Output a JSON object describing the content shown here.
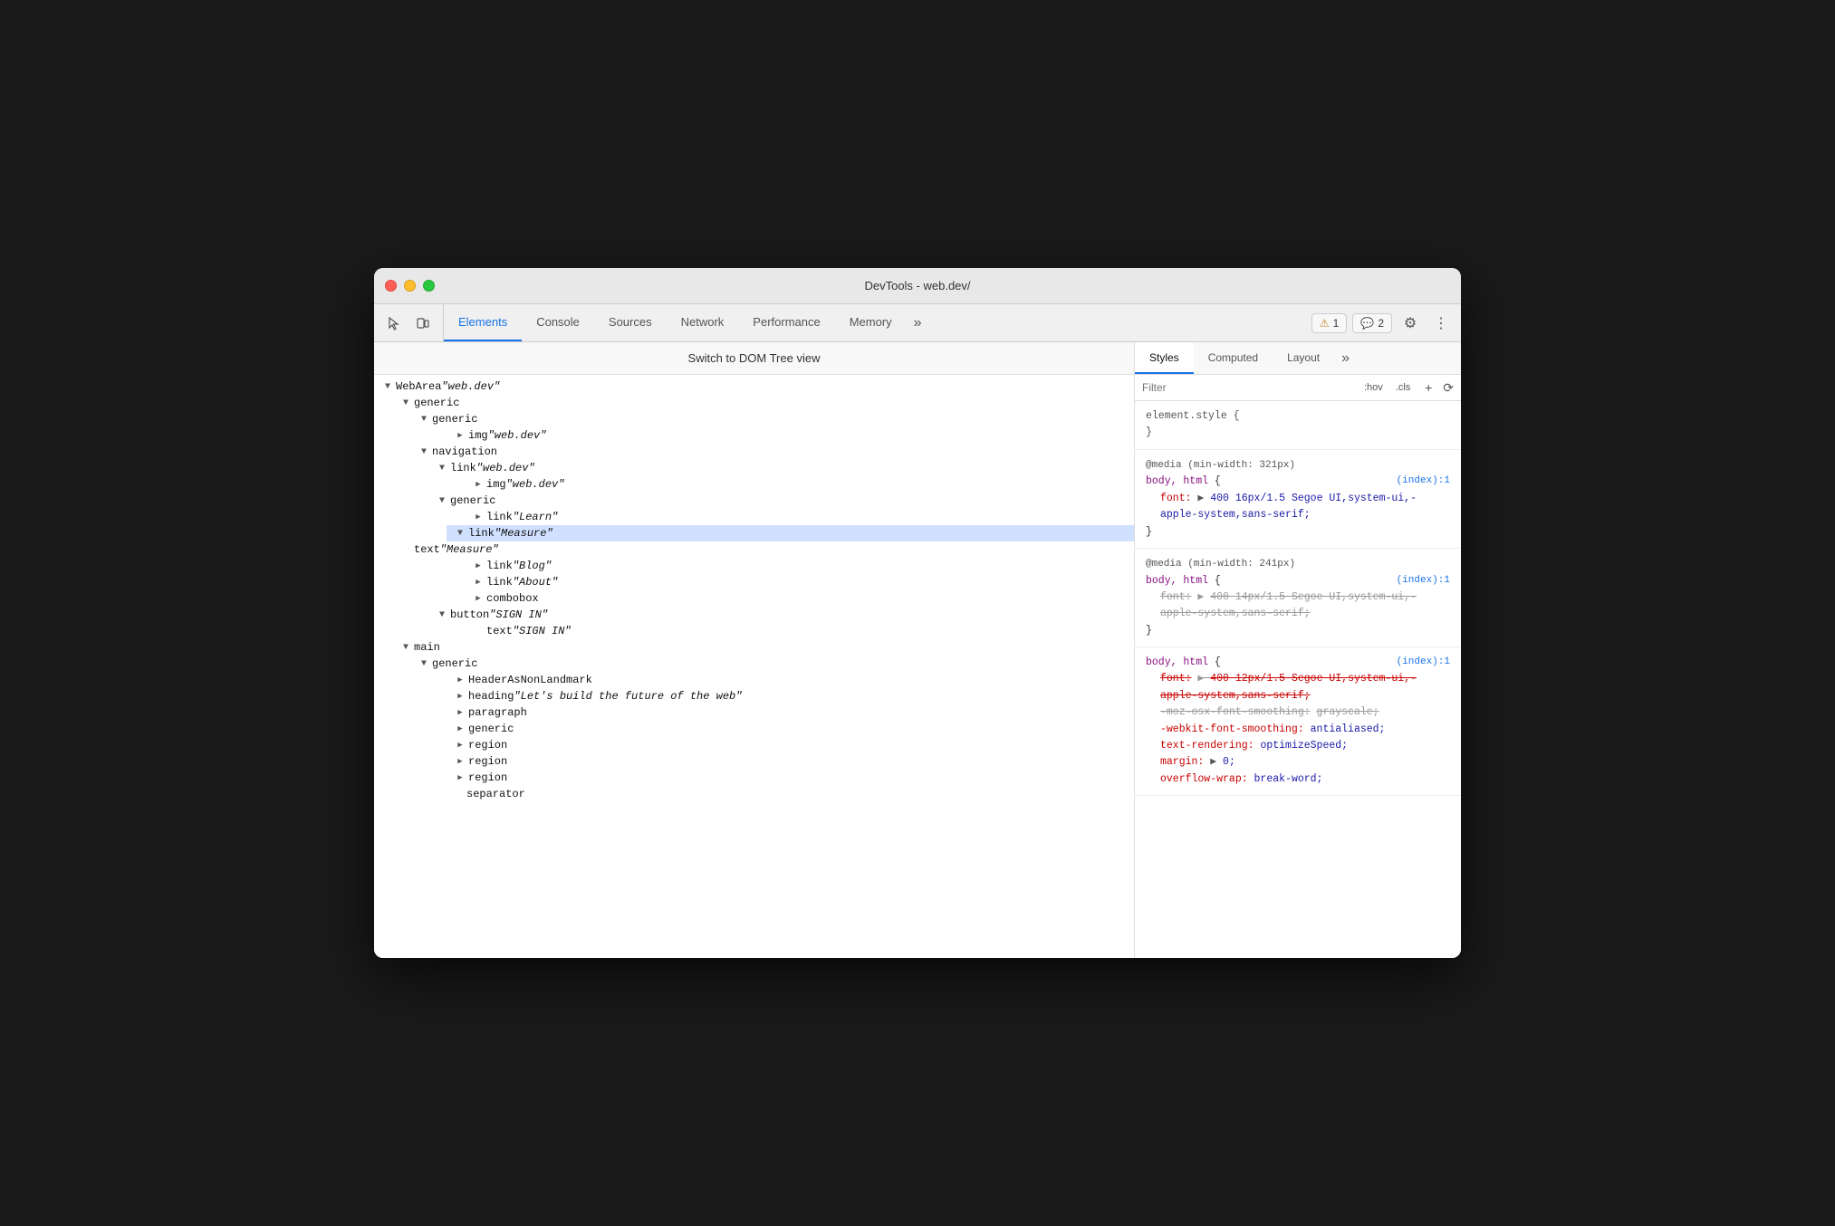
{
  "window": {
    "title": "DevTools - web.dev/"
  },
  "toolbar": {
    "tabs": [
      {
        "id": "elements",
        "label": "Elements",
        "active": true
      },
      {
        "id": "console",
        "label": "Console",
        "active": false
      },
      {
        "id": "sources",
        "label": "Sources",
        "active": false
      },
      {
        "id": "network",
        "label": "Network",
        "active": false
      },
      {
        "id": "performance",
        "label": "Performance",
        "active": false
      },
      {
        "id": "memory",
        "label": "Memory",
        "active": false
      }
    ],
    "more_label": "»",
    "warnings_count": "1",
    "messages_count": "2"
  },
  "left_panel": {
    "switch_bar_label": "Switch to DOM Tree view",
    "tree": [
      {
        "level": 0,
        "expanded": true,
        "arrow": "▼",
        "role": "WebArea",
        "name": "\"web.dev\""
      },
      {
        "level": 1,
        "expanded": true,
        "arrow": "▼",
        "role": "generic",
        "name": ""
      },
      {
        "level": 2,
        "expanded": true,
        "arrow": "▼",
        "role": "generic",
        "name": ""
      },
      {
        "level": 3,
        "expanded": false,
        "arrow": "▶",
        "role": "img",
        "name": "\"web.dev\"",
        "extra_indent": true
      },
      {
        "level": 2,
        "expanded": true,
        "arrow": "▼",
        "role": "navigation",
        "name": ""
      },
      {
        "level": 3,
        "expanded": true,
        "arrow": "▼",
        "role": "link",
        "name": "\"web.dev\""
      },
      {
        "level": 4,
        "expanded": false,
        "arrow": "▶",
        "role": "img",
        "name": "\"web.dev\""
      },
      {
        "level": 3,
        "expanded": true,
        "arrow": "▼",
        "role": "generic",
        "name": ""
      },
      {
        "level": 4,
        "expanded": false,
        "arrow": "▶",
        "role": "link",
        "name": "\"Learn\""
      },
      {
        "level": 4,
        "expanded": true,
        "arrow": "▼",
        "role": "link",
        "name": "\"Measure\"",
        "selected": true
      },
      {
        "level": 5,
        "expanded": false,
        "arrow": "",
        "role": "text",
        "name": "\"Measure\""
      },
      {
        "level": 4,
        "expanded": false,
        "arrow": "▶",
        "role": "link",
        "name": "\"Blog\""
      },
      {
        "level": 4,
        "expanded": false,
        "arrow": "▶",
        "role": "link",
        "name": "\"About\""
      },
      {
        "level": 4,
        "expanded": false,
        "arrow": "▶",
        "role": "combobox",
        "name": ""
      },
      {
        "level": 3,
        "expanded": true,
        "arrow": "▼",
        "role": "button",
        "name": "\"SIGN IN\""
      },
      {
        "level": 4,
        "expanded": false,
        "arrow": "",
        "role": "text",
        "name": "\"SIGN IN\""
      },
      {
        "level": 1,
        "expanded": true,
        "arrow": "▼",
        "role": "main",
        "name": ""
      },
      {
        "level": 2,
        "expanded": true,
        "arrow": "▼",
        "role": "generic",
        "name": ""
      },
      {
        "level": 3,
        "expanded": false,
        "arrow": "▶",
        "role": "HeaderAsNonLandmark",
        "name": ""
      },
      {
        "level": 3,
        "expanded": false,
        "arrow": "▶",
        "role": "heading",
        "name": "\"Let's build the future of the web\""
      },
      {
        "level": 3,
        "expanded": false,
        "arrow": "▶",
        "role": "paragraph",
        "name": ""
      },
      {
        "level": 3,
        "expanded": false,
        "arrow": "▶",
        "role": "generic",
        "name": ""
      },
      {
        "level": 3,
        "expanded": false,
        "arrow": "▶",
        "role": "region",
        "name": ""
      },
      {
        "level": 3,
        "expanded": false,
        "arrow": "▶",
        "role": "region",
        "name": ""
      },
      {
        "level": 3,
        "expanded": false,
        "arrow": "▶",
        "role": "region",
        "name": ""
      },
      {
        "level": 3,
        "expanded": false,
        "arrow": "",
        "role": "separator",
        "name": ""
      }
    ]
  },
  "right_panel": {
    "tabs": [
      {
        "id": "styles",
        "label": "Styles",
        "active": true
      },
      {
        "id": "computed",
        "label": "Computed",
        "active": false
      },
      {
        "id": "layout",
        "label": "Layout",
        "active": false
      }
    ],
    "more_label": "»",
    "filter_placeholder": "Filter",
    "filter_hov": ":hov",
    "filter_cls": ".cls",
    "css_rules": [
      {
        "id": "element_style",
        "selector": "element.style {",
        "close": "}",
        "properties": []
      },
      {
        "id": "media_321",
        "media": "@media (min-width: 321px)",
        "selector": "body, html {",
        "source": "(index):1",
        "close": "}",
        "properties": [
          {
            "name": "font:",
            "arrow": "▶",
            "value": "400 16px/1.5 Segoe UI,system-ui,-apple-system,sans-serif;",
            "strikethrough": false
          }
        ]
      },
      {
        "id": "media_241",
        "media": "@media (min-width: 241px)",
        "selector": "body, html {",
        "source": "(index):1",
        "close": "}",
        "properties": [
          {
            "name": "font:",
            "arrow": "▶",
            "value": "400 14px/1.5 Segoe UI,system-ui,-apple-system,sans-serif;",
            "strikethrough": true
          }
        ]
      },
      {
        "id": "body_html_3",
        "selector": "body, html {",
        "source": "(index):1",
        "close": "}",
        "properties": [
          {
            "name": "font:",
            "arrow": "▶",
            "value": "400 12px/1.5 Segoe UI,system-ui,-apple-system,sans-serif;",
            "strikethrough": true,
            "red": true
          },
          {
            "name": "-moz-osx-font-smoothing:",
            "value": "grayscale;",
            "strikethrough": true,
            "red": false,
            "muted": true
          },
          {
            "name": "-webkit-font-smoothing:",
            "value": "antialiased;",
            "strikethrough": false,
            "red": true
          },
          {
            "name": "text-rendering:",
            "value": "optimizeSpeed;",
            "strikethrough": false,
            "red": true
          },
          {
            "name": "margin:",
            "arrow": "▶",
            "value": "0;",
            "strikethrough": false,
            "red": true
          },
          {
            "name": "overflow-wrap:",
            "value": "break-word;",
            "strikethrough": false,
            "red": true,
            "partial": true
          }
        ]
      }
    ]
  }
}
